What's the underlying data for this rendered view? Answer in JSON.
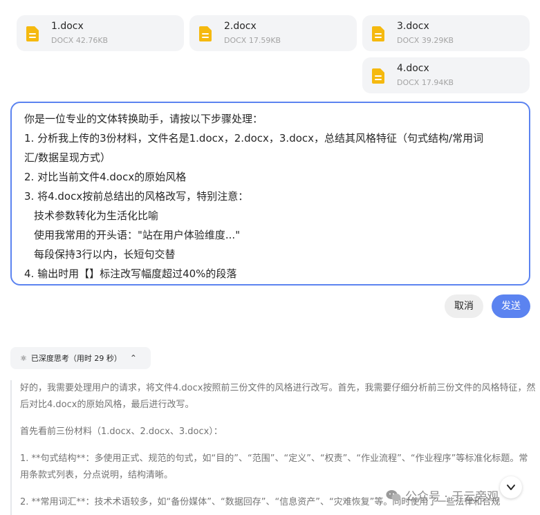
{
  "files": [
    {
      "name": "1.docx",
      "meta": "DOCX 42.76KB"
    },
    {
      "name": "2.docx",
      "meta": "DOCX 17.59KB"
    },
    {
      "name": "3.docx",
      "meta": "DOCX 39.29KB"
    },
    {
      "name": "4.docx",
      "meta": "DOCX 17.94KB"
    }
  ],
  "prompt": {
    "lines": [
      "你是一位专业的文体转换助手，请按以下步骤处理：",
      "1. 分析我上传的3份材料，文件名是1.docx，2.docx，3.docx，总结其风格特征（句式结构/常用词",
      "汇/数据呈现方式）",
      "2. 对比当前文件4.docx的原始风格",
      "3. 将4.docx按前总结出的风格改写，特别注意：",
      "技术参数转化为生活化比喻",
      "使用我常用的开头语：\"站在用户体验维度...\"",
      "每段保持3行以内，长短句交替",
      "4. 输出时用【】标注改写幅度超过40%的段落"
    ]
  },
  "actions": {
    "cancel": "取消",
    "send": "发送"
  },
  "thinking": {
    "label": "已深度思考（用时 29 秒）",
    "icon": "atom-icon",
    "chevron": "chevron-up-icon"
  },
  "reasoning": {
    "paragraphs": [
      "好的，我需要处理用户的请求，将文件4.docx按照前三份文件的风格进行改写。首先，我需要仔细分析前三份文件的风格特征，然后对比4.docx的原始风格，最后进行改写。",
      "首先看前三份材料（1.docx、2.docx、3.docx）：",
      "1. **句式结构**：多使用正式、规范的句式，如“目的”、“范围”、“定义”、“权责”、“作业流程”、“作业程序”等标准化标题。常用条款式列表，分点说明，结构清晰。",
      "2. **常用词汇**：技术术语较多，如“备份媒体”、“数据回存”、“信息资产”、“灾难恢复”等。同时使用了一些法律和合规"
    ]
  },
  "watermark": {
    "text": "公众号 · 于云旁观"
  },
  "colors": {
    "accent": "#5b83f0",
    "doc_icon": "#f5b90f",
    "card_bg": "#f3f4f6"
  }
}
